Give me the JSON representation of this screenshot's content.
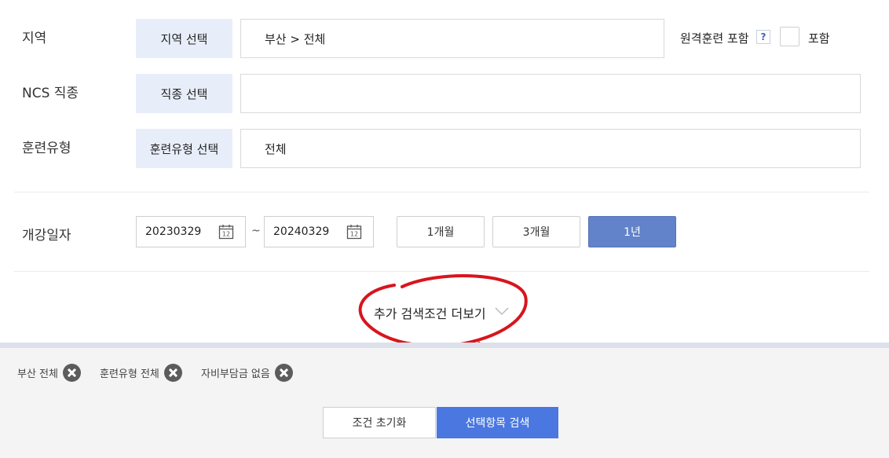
{
  "region": {
    "label": "지역",
    "select_button": "지역 선택",
    "value": "부산 > 전체",
    "remote_label": "원격훈련 포함",
    "help_symbol": "?",
    "include_label": "포함"
  },
  "ncs": {
    "label": "NCS 직종",
    "select_button": "직종 선택",
    "value": ""
  },
  "training_type": {
    "label": "훈련유형",
    "select_button": "훈련유형 선택",
    "value": "전체"
  },
  "start_date": {
    "label": "개강일자",
    "from": "20230329",
    "separator": "~",
    "to": "20240329",
    "calendar_day": "12",
    "periods": [
      "1개월",
      "3개월",
      "1년"
    ],
    "active_period": "1년"
  },
  "more_filters": {
    "label": "추가 검색조건 더보기"
  },
  "selected_filters": [
    "부산 전체",
    "훈련유형 전체",
    "자비부담금 없음"
  ],
  "actions": {
    "reset": "조건 초기화",
    "search": "선택항목 검색"
  },
  "colors": {
    "select_bg": "#e8eef9",
    "active_period": "#6283c9",
    "search_button": "#4a78e0",
    "annotation": "#d8151c"
  }
}
